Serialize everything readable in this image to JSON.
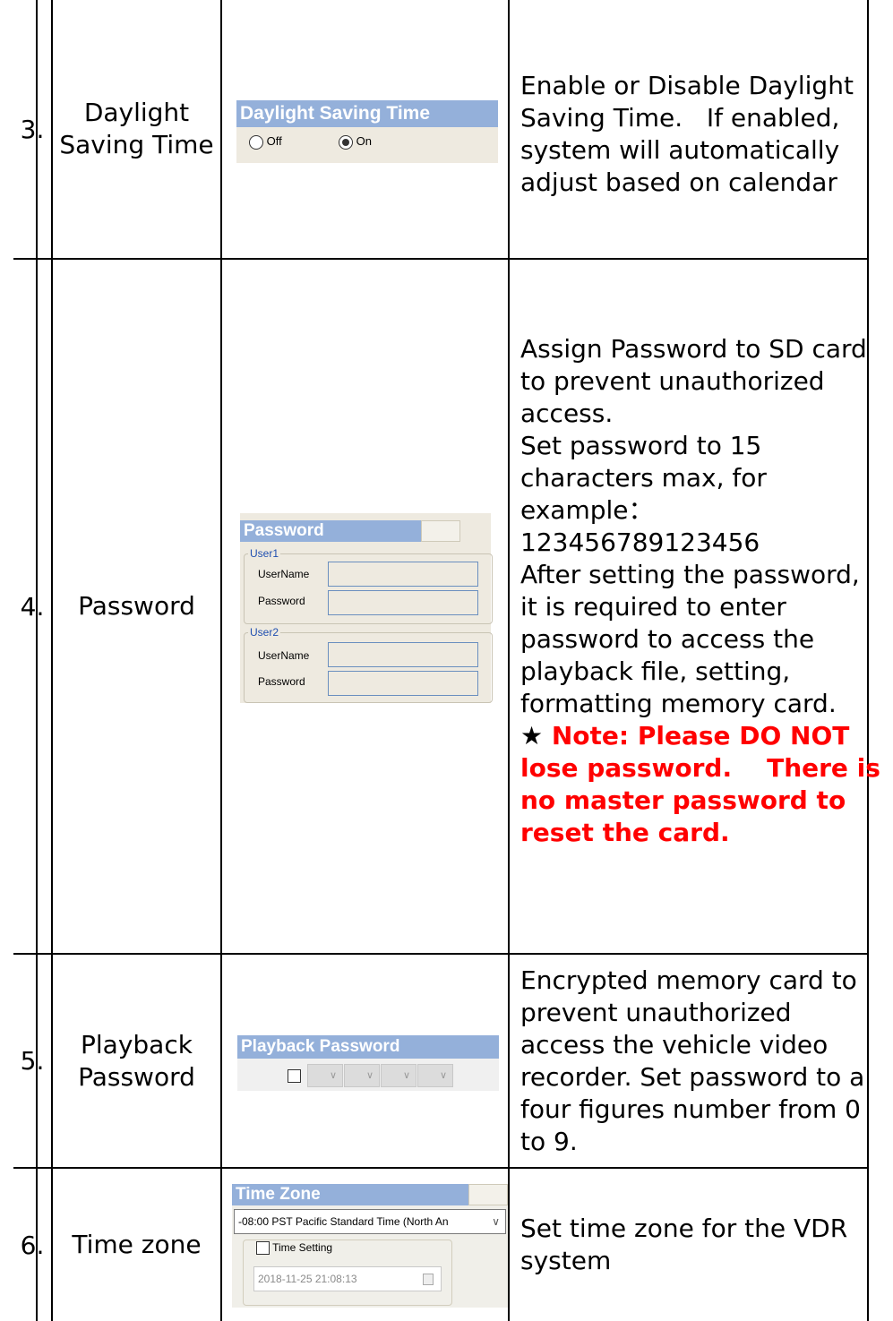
{
  "rows": [
    {
      "number": "3.",
      "function_lines": [
        "Daylight",
        "Saving Time"
      ],
      "desc_lines": [
        "Enable or Disable Daylight",
        "Saving Time.   If enabled,",
        "system will automatically",
        "adjust based on calendar"
      ],
      "widget": {
        "title": "Daylight Saving Time",
        "option_off": "Off",
        "option_on": "On",
        "selected": "On"
      }
    },
    {
      "number": "4.",
      "function_lines": [
        "Password"
      ],
      "desc_lines": [
        "Assign Password to SD card",
        "to prevent unauthorized",
        "access.",
        "Set password to 15",
        "characters max, for",
        "example：",
        "123456789123456",
        "After setting the password,",
        "it is required to enter",
        "password to access the",
        "playback file, setting,",
        "formatting memory card."
      ],
      "warning": {
        "star": "★",
        "lines": [
          " Note: Please DO NOT",
          "lose password.    There is",
          "no master password to",
          "reset the card."
        ]
      },
      "widget": {
        "title": "Password",
        "user1": "User1",
        "user2": "User2",
        "username_label": "UserName",
        "password_label": "Password"
      }
    },
    {
      "number": "5.",
      "function_lines": [
        "Playback",
        "Password"
      ],
      "desc_lines": [
        "Encrypted memory card to",
        "prevent unauthorized",
        "access the vehicle video",
        "recorder. Set password to a",
        "four figures number from 0",
        "to 9."
      ],
      "widget": {
        "title": "Playback Password"
      }
    },
    {
      "number": "6.",
      "function_lines": [
        "Time zone"
      ],
      "desc_lines": [
        "Set time zone for the VDR",
        "system"
      ],
      "widget": {
        "title": "Time Zone",
        "zone_value": "-08:00 PST Pacific Standard Time (North An",
        "time_setting_label": "Time Setting",
        "datetime_value": "2018-11-25 21:08:13"
      }
    }
  ]
}
